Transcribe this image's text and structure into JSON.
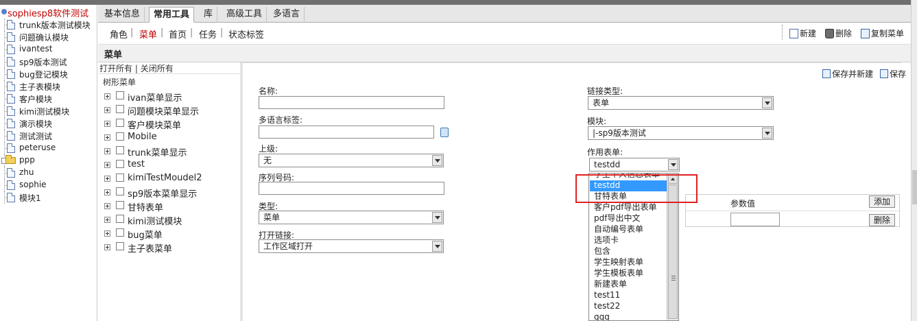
{
  "left_tree": {
    "root": "sophiesp8软件测试",
    "items": [
      {
        "label": "trunk版本测试模块",
        "icon": "doc"
      },
      {
        "label": "问题确认模块",
        "icon": "doc"
      },
      {
        "label": "ivantest",
        "icon": "doc"
      },
      {
        "label": "sp9版本测试",
        "icon": "doc"
      },
      {
        "label": "bug登记模块",
        "icon": "doc"
      },
      {
        "label": "主子表模块",
        "icon": "doc"
      },
      {
        "label": "客户模块",
        "icon": "doc"
      },
      {
        "label": "kimi测试模块",
        "icon": "doc"
      },
      {
        "label": "演示模块",
        "icon": "doc"
      },
      {
        "label": "测试测试",
        "icon": "doc"
      },
      {
        "label": "peteruse",
        "icon": "doc"
      },
      {
        "label": "ppp",
        "icon": "folder"
      },
      {
        "label": "zhu",
        "icon": "doc"
      },
      {
        "label": "sophie",
        "icon": "doc"
      },
      {
        "label": "模块1",
        "icon": "doc"
      }
    ]
  },
  "tabs": [
    "基本信息",
    "常用工具",
    "库",
    "高级工具",
    "多语言"
  ],
  "subnav": [
    "角色",
    "菜单",
    "首页",
    "任务",
    "状态标签"
  ],
  "toolbar": {
    "new": "新建",
    "delete": "删除",
    "copy": "复制菜单"
  },
  "section_title": "菜单",
  "mid_panel": {
    "open_all": "打开所有",
    "close_all": "关闭所有",
    "tree_title": "树形菜单",
    "nodes": [
      "ivan菜单显示",
      "问题模块菜单显示",
      "客户模块菜单",
      "Mobile",
      "trunk菜单显示",
      "test",
      "kimiTestMoudel2",
      "sp9版本菜单显示",
      "甘特表单",
      "kimi测试模块",
      "bug菜单",
      "主子表菜单"
    ]
  },
  "form": {
    "save_new": "保存并新建",
    "save": "保存",
    "name_label": "名称:",
    "lang_label": "多语言标签:",
    "parent_label": "上级:",
    "parent_value": "无",
    "seq_label": "序列号码:",
    "type_label": "类型:",
    "type_value": "菜单",
    "open_label": "打开链接:",
    "open_value": "工作区域打开",
    "link_type_label": "链接类型:",
    "link_type_value": "表单",
    "module_label": "模块:",
    "module_value": "|-sp9版本测试",
    "form_label": "作用表单:",
    "form_value": "testdd",
    "param_col2": "参数值",
    "add_btn": "添加",
    "del_btn": "删除"
  },
  "dropdown": {
    "items": [
      "学生个人信息表单",
      "testdd",
      "甘特表单",
      "客户pdf导出表单",
      "pdf导出中文",
      "自动编号表单",
      "选项卡",
      "包含",
      "学生映射表单",
      "学生模板表单",
      "新建表单",
      "test11",
      "test22",
      "ggg"
    ],
    "selected": "testdd"
  },
  "colors": {
    "accent_red": "#c00000",
    "highlight_blue": "#3399ff",
    "annotation_red": "#e02020"
  }
}
